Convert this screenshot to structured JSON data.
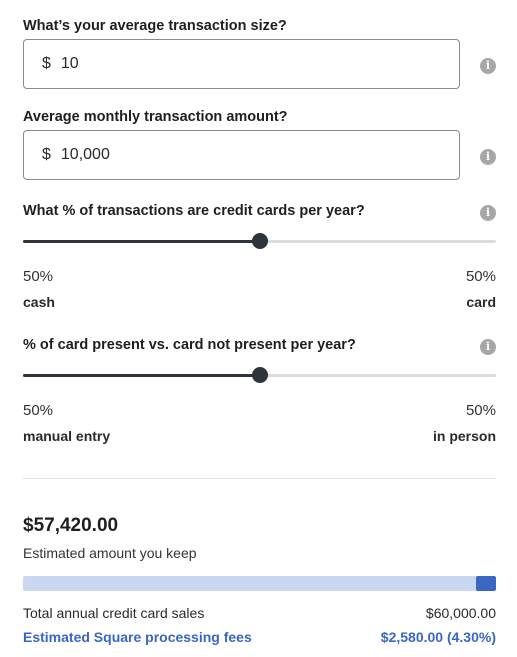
{
  "fields": {
    "avg_transaction": {
      "label": "What’s your average transaction size?",
      "currency": "$",
      "value": "10"
    },
    "monthly_amount": {
      "label": "Average monthly transaction amount?",
      "currency": "$",
      "value": "10,000"
    }
  },
  "sliders": {
    "credit": {
      "label": "What % of transactions are credit cards per year?",
      "value_fraction": 0.5,
      "left_pct": "50%",
      "left_label": "cash",
      "right_pct": "50%",
      "right_label": "card"
    },
    "present": {
      "label": "% of card present vs. card not present per year?",
      "value_fraction": 0.5,
      "left_pct": "50%",
      "left_label": "manual entry",
      "right_pct": "50%",
      "right_label": "in person"
    }
  },
  "results": {
    "kept_amount": "$57,420.00",
    "kept_label": "Estimated amount you keep",
    "fees_fraction": 0.043,
    "total_label": "Total annual credit card sales",
    "total_value": "$60,000.00",
    "fees_label": "Estimated Square processing fees",
    "fees_value": "$2,580.00 (4.30%)"
  },
  "icons": {
    "info": "info-icon"
  },
  "colors": {
    "accent": "#3a66c4",
    "accent_light": "#c9d7f2",
    "slider": "#2f343a"
  }
}
